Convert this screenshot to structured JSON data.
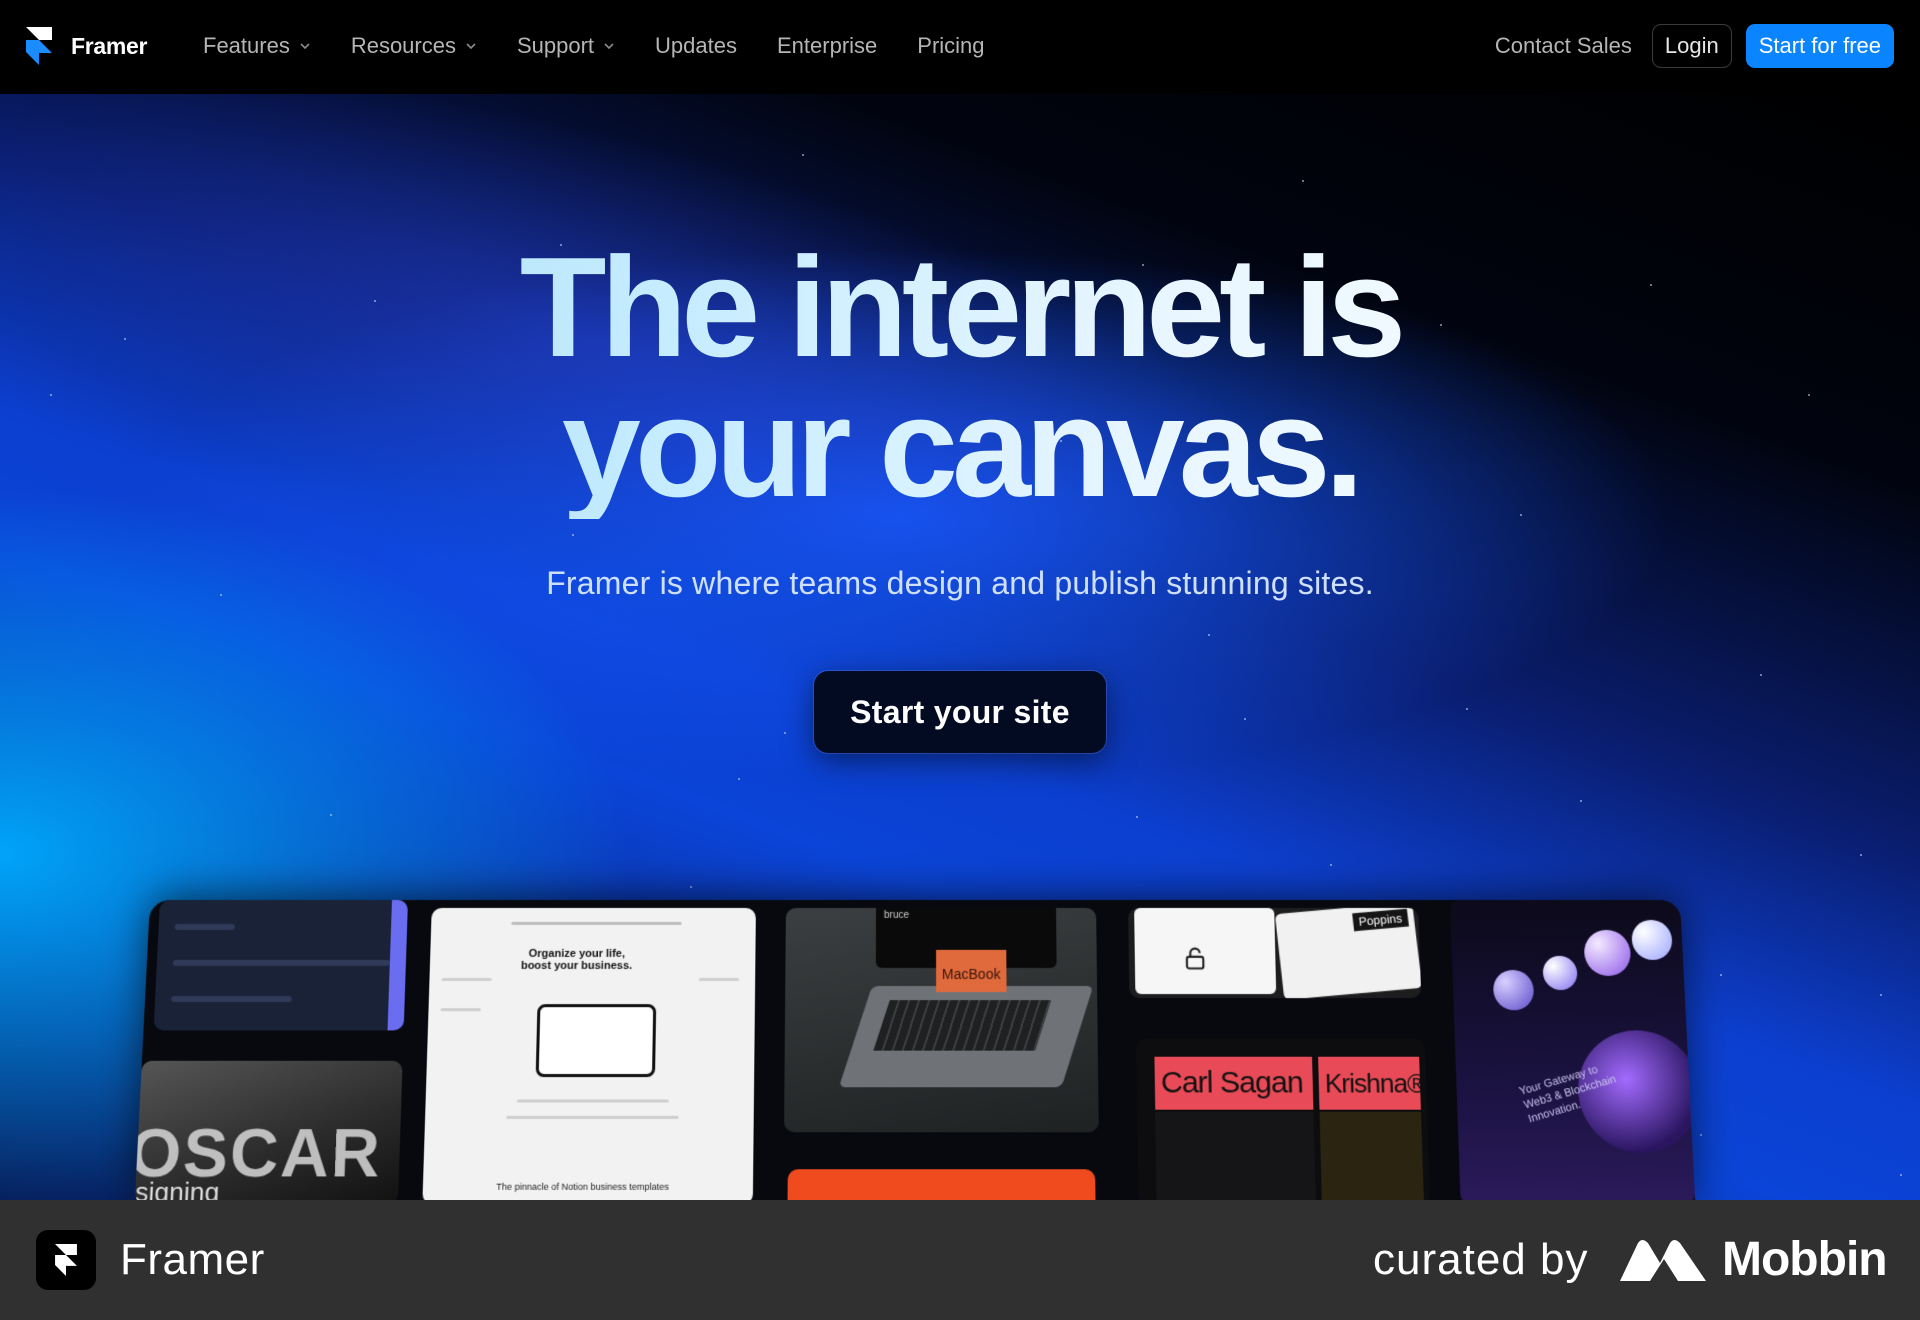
{
  "nav": {
    "brand": "Framer",
    "links": [
      {
        "label": "Features",
        "dropdown": true
      },
      {
        "label": "Resources",
        "dropdown": true
      },
      {
        "label": "Support",
        "dropdown": true
      },
      {
        "label": "Updates",
        "dropdown": false
      },
      {
        "label": "Enterprise",
        "dropdown": false
      },
      {
        "label": "Pricing",
        "dropdown": false
      }
    ],
    "contact": "Contact Sales",
    "login": "Login",
    "start_free": "Start for free"
  },
  "hero": {
    "headline_line1": "The internet is",
    "headline_line2": "your canvas.",
    "subtitle": "Framer is where teams design and publish stunning sites.",
    "cta": "Start your site"
  },
  "showcase": {
    "oscar": "OSCAR",
    "oscar_sub": "signing",
    "doc_title": "Organize your life, boost your business.",
    "doc_footer": "The pinnacle of Notion business templates",
    "laptop_label": "MacBook",
    "laptop_brand": "bruce",
    "type_badge": "Poppins",
    "poster_left": "Carl Sagan",
    "poster_right": "Krishna®",
    "web3_text": "Your Gateway to Web3 & Blockchain Innovation."
  },
  "footer": {
    "app_name": "Framer",
    "curated_by": "curated by",
    "mobbin": "Mobbin"
  },
  "colors": {
    "accent": "#0b84ff",
    "nav_bg": "#000000",
    "footer_bg": "#303030",
    "cta_bg": "#030b22"
  },
  "icons": [
    "framer-logo-icon",
    "chevron-down-icon",
    "mobbin-logo-icon"
  ]
}
